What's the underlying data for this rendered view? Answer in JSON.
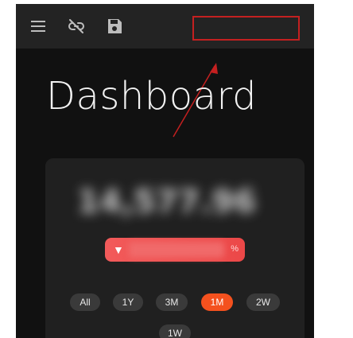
{
  "toolbar": {
    "menu_icon": "menu-icon",
    "unlink_icon": "link-off-icon",
    "save_icon": "save-icon"
  },
  "page": {
    "title": "Dashboard"
  },
  "card": {
    "value_text": "14,577.96",
    "change_direction": "down",
    "change_arrow": "▼",
    "change_unit": "%"
  },
  "ranges": [
    "All",
    "1Y",
    "3M",
    "1M",
    "2W",
    "1W"
  ],
  "active_range": "1M",
  "colors": {
    "background": "#111111",
    "toolbar": "#232323",
    "card": "#202020",
    "accent": "#f4511e",
    "negative": "#ef5350",
    "annotation": "#c42020"
  }
}
